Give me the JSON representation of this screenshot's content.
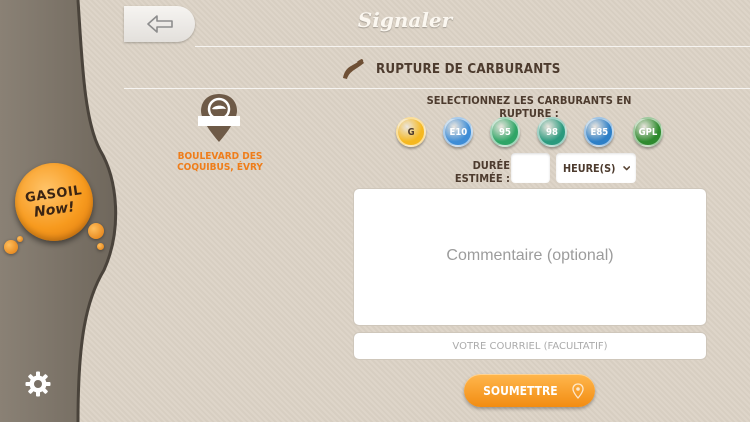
{
  "header": {
    "title": "Signaler",
    "back_icon": "arrow-left-icon"
  },
  "section": {
    "title": "RUPTURE DE CARBURANTS",
    "icon": "fuel-nozzle-icon"
  },
  "location": {
    "address": "BOULEVARD DES COQUIBUS, ÉVRY",
    "icon": "station-pin-icon"
  },
  "fuel_selection": {
    "label": "SELECTIONNEZ LES CARBURANTS EN RUPTURE :",
    "fuels": [
      {
        "label": "G",
        "color": "#f5b820",
        "text_color": "#4d3b2e"
      },
      {
        "label": "E10",
        "color": "#3e8dd6",
        "text_color": "#ffffff"
      },
      {
        "label": "95",
        "color": "#2fa566",
        "text_color": "#ffffff"
      },
      {
        "label": "98",
        "color": "#2b9a7e",
        "text_color": "#ffffff"
      },
      {
        "label": "E85",
        "color": "#2d7fc7",
        "text_color": "#ffffff"
      },
      {
        "label": "GPL",
        "color": "#2e8a2e",
        "text_color": "#ffffff"
      }
    ]
  },
  "duration": {
    "label": "DURÉE ESTIMÉE :",
    "value": "",
    "unit": "HEURE(S)",
    "dropdown_icon": "chevron-down-icon"
  },
  "comment": {
    "placeholder": "Commentaire (optional)"
  },
  "email": {
    "placeholder": "VOTRE COURRIEL (FACULTATIF)"
  },
  "submit": {
    "label": "SOUMETTRE",
    "icon": "location-pin-icon"
  },
  "sidebar": {
    "logo_line1": "GASOIL",
    "logo_line2": "Now!",
    "settings_icon": "gear-icon"
  },
  "colors": {
    "accent_orange": "#f28c12",
    "text_brown": "#4d3b2e",
    "address_orange": "#ef7d1a",
    "background": "#dcd3c6"
  }
}
